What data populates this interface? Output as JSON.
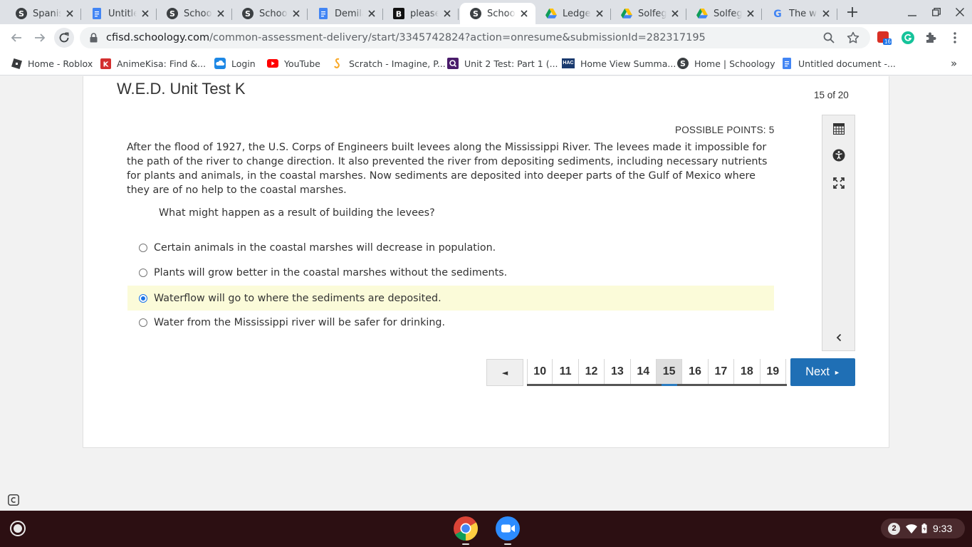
{
  "browser": {
    "tabs": [
      {
        "title": "Spanish",
        "icon": "schoology-icon"
      },
      {
        "title": "Untitled",
        "icon": "docs-icon"
      },
      {
        "title": "Schoology",
        "icon": "schoology-icon"
      },
      {
        "title": "Schoology",
        "icon": "schoology-icon"
      },
      {
        "title": "Demila",
        "icon": "docs-icon"
      },
      {
        "title": "please",
        "icon": "brainly-icon"
      },
      {
        "title": "Schoology",
        "icon": "schoology-icon",
        "active": true
      },
      {
        "title": "Ledger",
        "icon": "drive-icon"
      },
      {
        "title": "Solfege",
        "icon": "drive-icon"
      },
      {
        "title": "Solfege",
        "icon": "drive-icon"
      },
      {
        "title": "The wa",
        "icon": "google-icon"
      }
    ],
    "url_domain": "cfisd.schoology.com",
    "url_path": "/common-assessment-delivery/start/3345742824?action=onresume&submissionId=282317195",
    "extension_badge": "16",
    "bookmarks": [
      {
        "label": "Home - Roblox",
        "icon": "roblox-icon"
      },
      {
        "label": "AnimeKisa: Find &...",
        "icon": "animekisa-icon"
      },
      {
        "label": "Login",
        "icon": "cloud-icon"
      },
      {
        "label": "YouTube",
        "icon": "youtube-icon"
      },
      {
        "label": "Scratch - Imagine, P...",
        "icon": "scratch-icon"
      },
      {
        "label": "Unit 2 Test: Part 1 (...",
        "icon": "quizlet-icon"
      },
      {
        "label": "Home View Summa...",
        "icon": "hac-icon"
      },
      {
        "label": "Home | Schoology",
        "icon": "schoology-icon"
      },
      {
        "label": "Untitled document -...",
        "icon": "docs-icon"
      }
    ],
    "bookmarks_overflow": "»",
    "hac_text": "HAC"
  },
  "assessment": {
    "title": "W.E.D. Unit Test K",
    "progress": "15 of 20",
    "possible_points": "POSSIBLE POINTS: 5",
    "passage": "After the flood of 1927, the U.S. Corps of Engineers built levees along the Mississippi River. The levees made it impossible for the path of the river to change direction. It also prevented the river from depositing sediments, including necessary nutrients for plants and animals, in the coastal marshes. Now sediments are deposited into deeper parts of the Gulf of Mexico where they are of no help to the coastal marshes.",
    "question": "What might happen as a result of building the levees?",
    "choices": [
      {
        "label": "Certain animals in the coastal marshes will decrease in population.",
        "selected": false
      },
      {
        "label": "Plants will grow better in the coastal marshes without the sediments.",
        "selected": false
      },
      {
        "label": "Waterflow will go to where the sediments are deposited.",
        "selected": true
      },
      {
        "label": "Water from the Mississippi river will be safer for drinking.",
        "selected": false
      }
    ],
    "pages": [
      "10",
      "11",
      "12",
      "13",
      "14",
      "15",
      "16",
      "17",
      "18",
      "19"
    ],
    "current_page": "15",
    "prev_symbol": "◄",
    "next_label": "Next",
    "next_symbol": "►"
  },
  "shelf": {
    "notification_count": "2",
    "time": "9:33"
  },
  "colors": {
    "next_button": "#1f6fb5",
    "selected_choice_bg": "#fbfbd9",
    "shelf_bg": "#2c0f12"
  }
}
